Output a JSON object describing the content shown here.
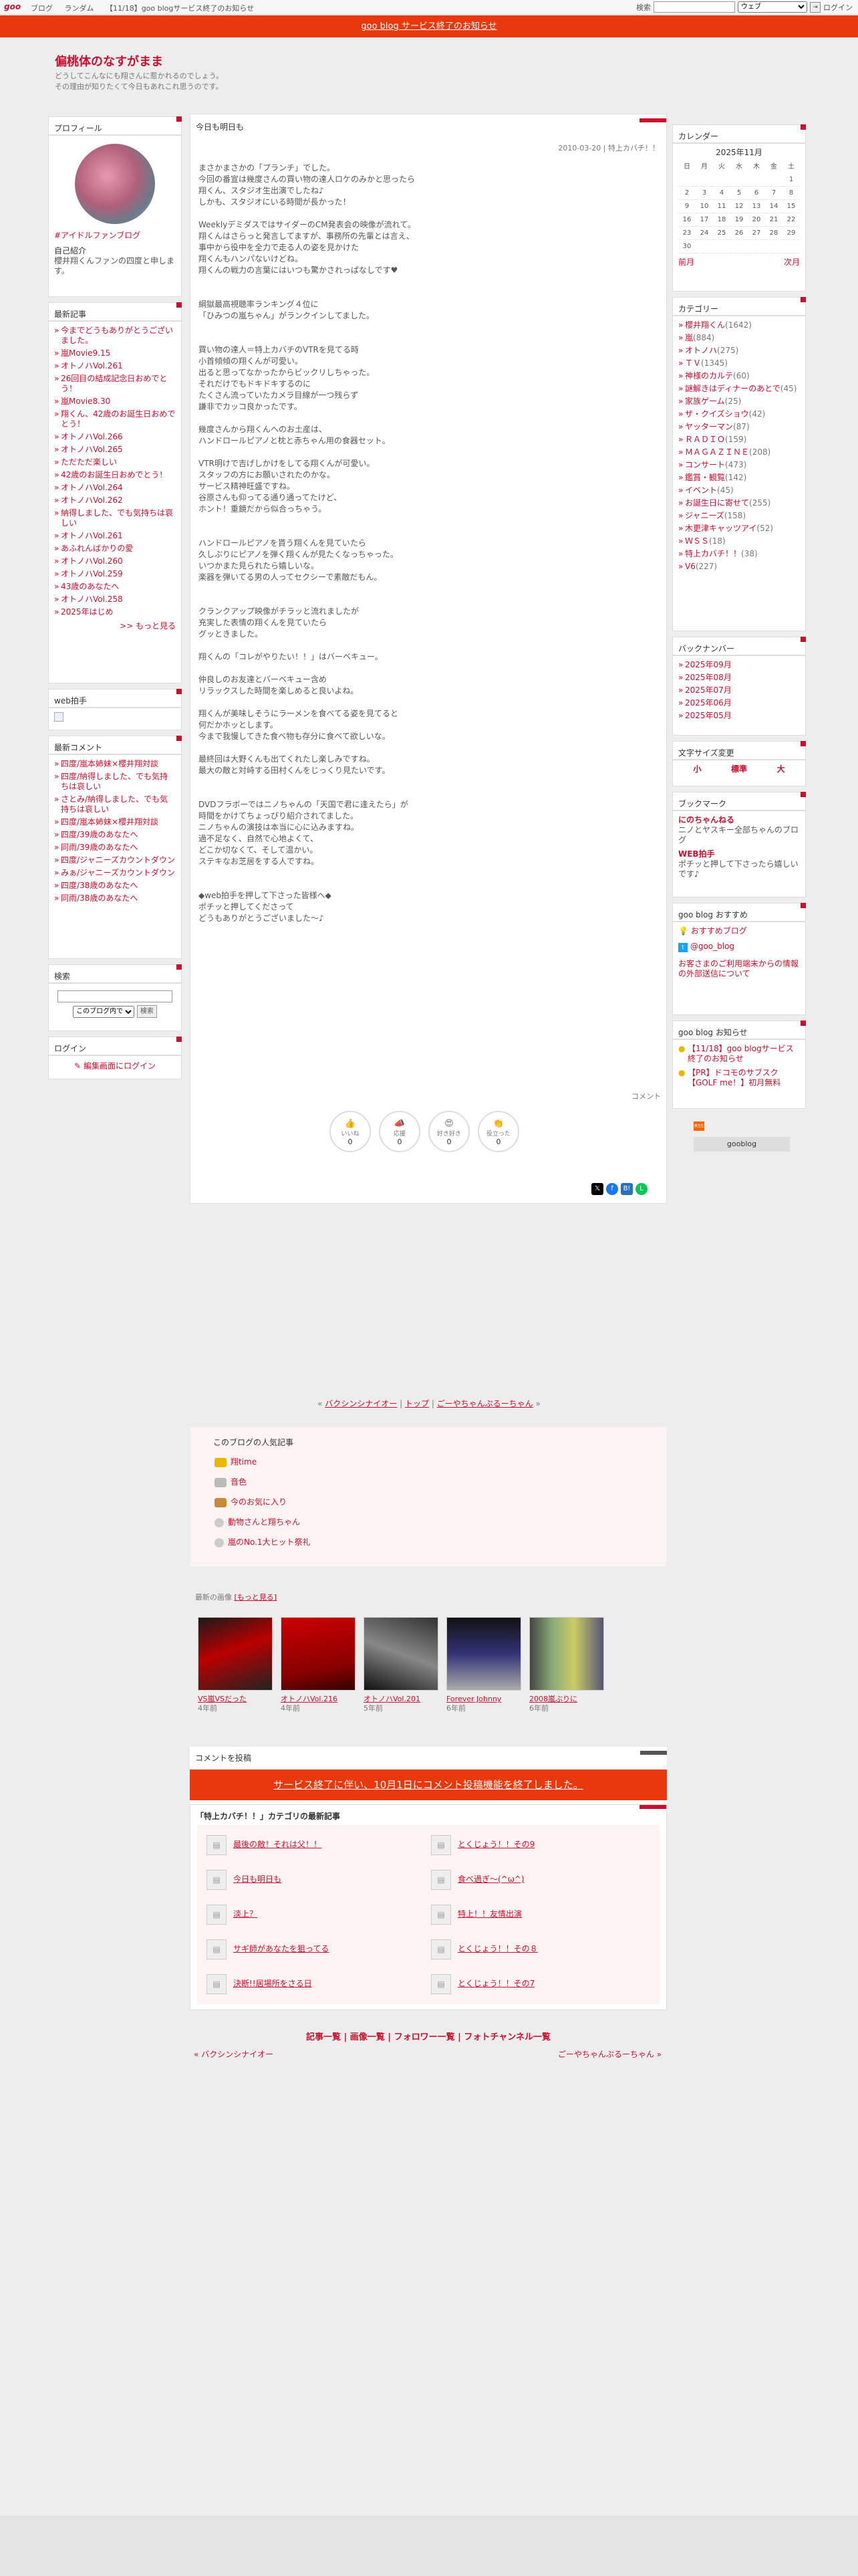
{
  "topbar": {
    "logo": "goo",
    "nav": [
      "ブログ",
      "ランダム",
      "【11/18】goo blogサービス終了のお知らせ"
    ],
    "search_label": "検索",
    "search_select": "ウェブ",
    "login": "ログイン"
  },
  "banner": "goo blog サービス終了のお知らせ",
  "blog": {
    "title": "偏桃体のなすがまま",
    "desc": "どうしてこんなにも翔さんに惹かれるのでしょう。\nその理由が知りたくて今日もあれこれ思うのです。"
  },
  "profile": {
    "title": "プロフィール",
    "name": "#アイドルファンブログ",
    "intro_label": "自己紹介",
    "intro": "櫻井翔くんファンの四度と申します。"
  },
  "recent": {
    "title": "最新記事",
    "items": [
      "今までどうもありがとうございました。",
      "嵐Movie9.15",
      "オトノハVol.261",
      "26回目の結成記念日おめでとう！",
      "嵐Movie8.30",
      "翔くん、42歳のお誕生日おめでとう！",
      "オトノハVol.266",
      "オトノハVol.265",
      "ただただ楽しい",
      "42歳のお誕生日おめでとう！",
      "オトノハVol.264",
      "オトノハVol.262",
      "納得しました、でも気持ちは哀しい",
      "オトノハVol.261",
      "あふれんばかりの愛",
      "オトノハVol.260",
      "オトノハVol.259",
      "43歳のあなたへ",
      "オトノハVol.258",
      "2025年はじめ"
    ],
    "more": ">> もっと見る"
  },
  "webbyte": {
    "title": "web拍手"
  },
  "comments": {
    "title": "最新コメント",
    "items": [
      "四度/嵐本姉妹×櫻井翔対談",
      "四度/納得しました、でも気持ちは哀しい",
      "さとみ/納得しました、でも気持ちは哀しい",
      "四度/嵐本姉妹×櫻井翔対談",
      "四度/39歳のあなたへ",
      "同雨/39歳のあなたへ",
      "四度/ジャニーズカウントダウン",
      "みぁ/ジャニーズカウントダウン",
      "四度/38歳のあなたへ",
      "同雨/38歳のあなたへ"
    ]
  },
  "search": {
    "title": "検索",
    "select": "このブログ内で",
    "button": "検索"
  },
  "login": {
    "title": "ログイン",
    "link": "編集画面にログイン"
  },
  "post": {
    "title": "今日も明日も",
    "meta": "2010-03-20 | 特上カバチ！！",
    "body": "まさかまさかの「プランチ」でした。\n今回の番宣は幾度さんの買い物の達人ロケのみかと思ったら\n翔くん、スタジオ生出演でしたね♪\nしかも、スタジオにいる時間が長かった！\n\nWeeklyデミダスではサイダーのCM発表会の映像が流れて。\n翔くんはさらっと発言してますが、事務所の先輩とは言え、\n事中から役中を全力で走る人の姿を見かけた\n翔くんもハンパないけどね。\n翔くんの戦力の言葉にはいつも驚かされっぱなしです♥\n\n\n綱獄最高視聴率ランキング４位に\n「ひみつの嵐ちゃん」がランクインしてました。\n\n\n買い物の達人＝特上カバチのVTRを見てる時\n小首傾傾の翔くんが可愛い。\n出ると思ってなかったからビックリしちゃった。\nそれだけでもドキドキするのに\nたくさん流っていたカメラ目線が一つ残らず\n謙非でカッコ良かったです。\n\n幾度さんから翔くんへのお土産は、\nハンドロールピアノと枕と赤ちゃん用の食器セット。\n\nVTR明けで吉げしかけをしてる翔くんが可愛い。\nスタッフの方にお願いされたのかな。\nサービス精神旺盛ですね。\n谷原さんも仰ってる通り通ってたけど、\nホント！重鏡だから似合っちゃう。\n\n\nハンドロールピアノを貰う翔くんを見ていたら\n久しぶりにピアノを弾く翔くんが見たくなっちゃった。\nいつかまた見られたら嬉しいな。\n楽器を弾いてる男の人ってセクシーで素敵だもん。\n\n\nクランクアップ映像がチラッと流れましたが\n充実した表情の翔くんを見ていたら\nグッときました。\n\n翔くんの「コレがやりたい！！」はバーベキュー。\n\n仲良しのお友達とバーベキュー含め\nリラックスした時間を楽しめると良いよね。\n\n翔くんが美味しそうにラーメンを食べてる姿を見てると\n何だかホッとします。\n今まで我慢してきた食べ物も存分に食べて欲しいな。\n\n最終回は大野くんも出てくれたし楽しみですね。\n最大の敵と対峙する田村くんをじっくり見たいです。\n\n\nDVDフラボーではニノちゃんの「天国で君に逢えたら」が\n時間をかけてちょっぴり紹介されてました。\nニノちゃんの演技は本当に心に込みますね。\n過不足なく、自然で心地よくて、\nどこか切なくて、そして温かい。\nステキなお芝居をする人ですね。\n\n\n◆web拍手を押して下さった皆様へ◆\nポチッと押してくださって\nどうもありがとうございました〜♪",
    "comment_label": "コメント",
    "reactions": [
      {
        "label": "いいね",
        "count": "0"
      },
      {
        "label": "応援",
        "count": "0"
      },
      {
        "label": "好き好き",
        "count": "0"
      },
      {
        "label": "役立った",
        "count": "0"
      }
    ]
  },
  "calendar": {
    "title": "カレンダー",
    "month": "2025年11月",
    "dow": [
      "日",
      "月",
      "火",
      "水",
      "木",
      "金",
      "土"
    ],
    "weeks": [
      [
        "",
        "",
        "",
        "",
        "",
        "",
        "1"
      ],
      [
        "2",
        "3",
        "4",
        "5",
        "6",
        "7",
        "8"
      ],
      [
        "9",
        "10",
        "11",
        "12",
        "13",
        "14",
        "15"
      ],
      [
        "16",
        "17",
        "18",
        "19",
        "20",
        "21",
        "22"
      ],
      [
        "23",
        "24",
        "25",
        "26",
        "27",
        "28",
        "29"
      ],
      [
        "30",
        "",
        "",
        "",
        "",
        "",
        ""
      ]
    ],
    "prev": "前月",
    "next": "次月"
  },
  "category": {
    "title": "カテゴリー",
    "items": [
      {
        "n": "櫻井翔くん",
        "c": "(1642)"
      },
      {
        "n": "嵐",
        "c": "(884)"
      },
      {
        "n": "オトノハ",
        "c": "(275)"
      },
      {
        "n": "ＴＶ",
        "c": "(1345)"
      },
      {
        "n": "神様のカルテ",
        "c": "(60)"
      },
      {
        "n": "謎解きはディナーのあとで",
        "c": "(45)"
      },
      {
        "n": "家族ゲーム",
        "c": "(25)"
      },
      {
        "n": "ザ・クイズショウ",
        "c": "(42)"
      },
      {
        "n": "ヤッターマン",
        "c": "(87)"
      },
      {
        "n": "ＲＡＤＩＯ",
        "c": "(159)"
      },
      {
        "n": "ＭＡＧＡＺＩＮＥ",
        "c": "(208)"
      },
      {
        "n": "コンサート",
        "c": "(473)"
      },
      {
        "n": "鑑賞・観覧",
        "c": "(142)"
      },
      {
        "n": "イベント",
        "c": "(45)"
      },
      {
        "n": "お誕生日に寄せて",
        "c": "(255)"
      },
      {
        "n": "ジャニーズ",
        "c": "(158)"
      },
      {
        "n": "木更津キャッツアイ",
        "c": "(52)"
      },
      {
        "n": "ＷＳＳ",
        "c": "(18)"
      },
      {
        "n": "特上カバチ！！",
        "c": "(38)"
      },
      {
        "n": "V6",
        "c": "(227)"
      }
    ]
  },
  "backnumber": {
    "title": "バックナンバー",
    "items": [
      "2025年09月",
      "2025年08月",
      "2025年07月",
      "2025年06月",
      "2025年05月"
    ]
  },
  "fontsize": {
    "title": "文字サイズ変更",
    "items": [
      "小",
      "標準",
      "大"
    ]
  },
  "bookmark": {
    "title": "ブックマーク",
    "items": [
      {
        "n": "にのちゃんねる",
        "d": "ニノとヤスキー全部ちゃんのブログ"
      },
      {
        "n": "WEB拍手",
        "d": "ポチッと押して下さったら嬉しいです♪"
      }
    ]
  },
  "recommend": {
    "title": "goo blog おすすめ",
    "items": [
      "おすすめブログ",
      "@goo_blog"
    ],
    "note": "お客さまのご利用端末からの情報の外部送信について"
  },
  "notice": {
    "title": "goo blog お知らせ",
    "items": [
      "【11/18】goo blogサービス終了のお知らせ",
      "【PR】ドコモのサブスク【GOLF me！】初月無料"
    ]
  },
  "rss": "RSS",
  "goologo": "gooblog",
  "pager": {
    "prev": "バクシンシナイオー",
    "top": "トップ",
    "next": "ごーやちゃんぷるーちゃん"
  },
  "popular": {
    "title": "このブログの人気記事",
    "items": [
      "翔time",
      "音色",
      "今のお気に入り",
      "動物さんと翔ちゃん",
      "嵐のNo.1大ヒット祭礼"
    ]
  },
  "images": {
    "title": "最新の画像",
    "more": "[もっと見る]",
    "items": [
      {
        "cap": "VS嵐VSだった",
        "age": "4年前"
      },
      {
        "cap": "オトノハVol.216",
        "age": "4年前"
      },
      {
        "cap": "オトノハVol.201",
        "age": "5年前"
      },
      {
        "cap": "Forever Johnny",
        "age": "6年前"
      },
      {
        "cap": "2008嵐ぶりに",
        "age": "6年前"
      }
    ]
  },
  "comment_post": {
    "title": "コメントを投稿",
    "notice": "サービス終了に伴い、10月1日にコメント投稿機能を終了しました。"
  },
  "cat_articles": {
    "title": "「特上カバチ！！」カテゴリの最新記事",
    "left": [
      "最後の敵！それは父！！",
      "今日も明日も",
      "淡上？",
      "サギ師があなたを狙ってる",
      "決断!!居場所をさる日"
    ],
    "right": [
      "とくじょう！！その9",
      "食べ過ぎ〜(^ω^)",
      "特上！！友情出演",
      "とくじょう！！その８",
      "とくじょう！！その7"
    ]
  },
  "footer": {
    "links": "記事一覧 | 画像一覧 | フォロワー一覧 | フォトチャンネル一覧",
    "prev": "« バクシンシナイオー",
    "next": "ごーやちゃんぷるーちゃん »"
  }
}
